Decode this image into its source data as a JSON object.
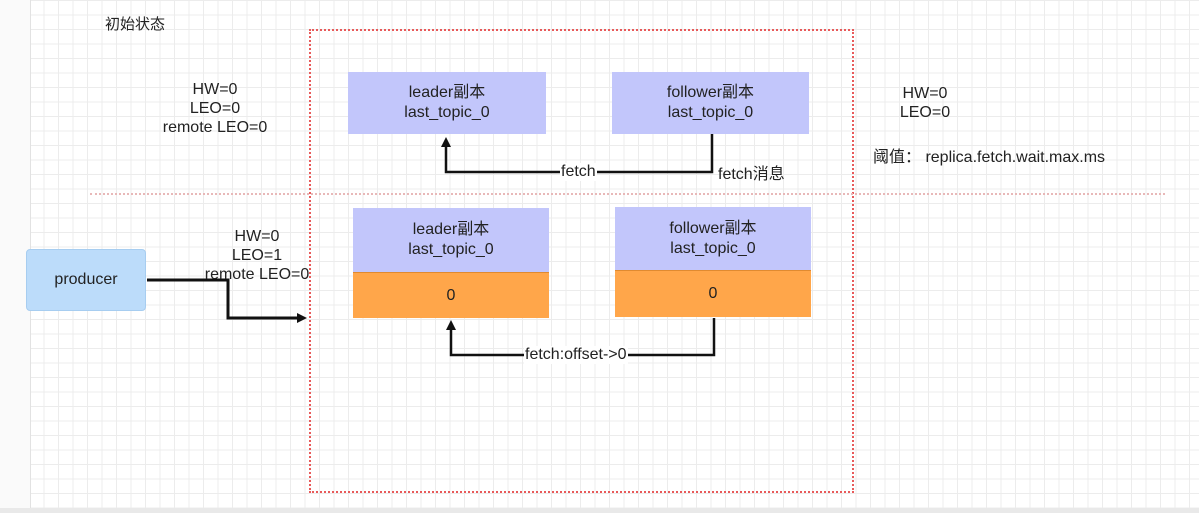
{
  "title": "初始状态",
  "top_row": {
    "leader": {
      "name": "leader副本",
      "topic": "last_topic_0"
    },
    "follower": {
      "name": "follower副本",
      "topic": "last_topic_0"
    },
    "leader_stats": {
      "hw": "HW=0",
      "leo": "LEO=0",
      "remote_leo": "remote LEO=0"
    },
    "follower_stats": {
      "hw": "HW=0",
      "leo": "LEO=0"
    },
    "fetch_label": "fetch",
    "fetch_msg_label": "fetch消息",
    "threshold": "阈值： replica.fetch.wait.max.ms"
  },
  "bottom_row": {
    "producer": "producer",
    "leader": {
      "name": "leader副本",
      "topic": "last_topic_0",
      "message": "0"
    },
    "follower": {
      "name": "follower副本",
      "topic": "last_topic_0",
      "message": "0"
    },
    "leader_stats": {
      "hw": "HW=0",
      "leo": "LEO=1",
      "remote_leo": "remote LEO=0"
    },
    "fetch_label": "fetch:offset->0"
  },
  "colors": {
    "replica": "#c2c6fb",
    "message": "#ffa64a",
    "producer": "#bcdcfa",
    "frame": "#e85a5a"
  }
}
